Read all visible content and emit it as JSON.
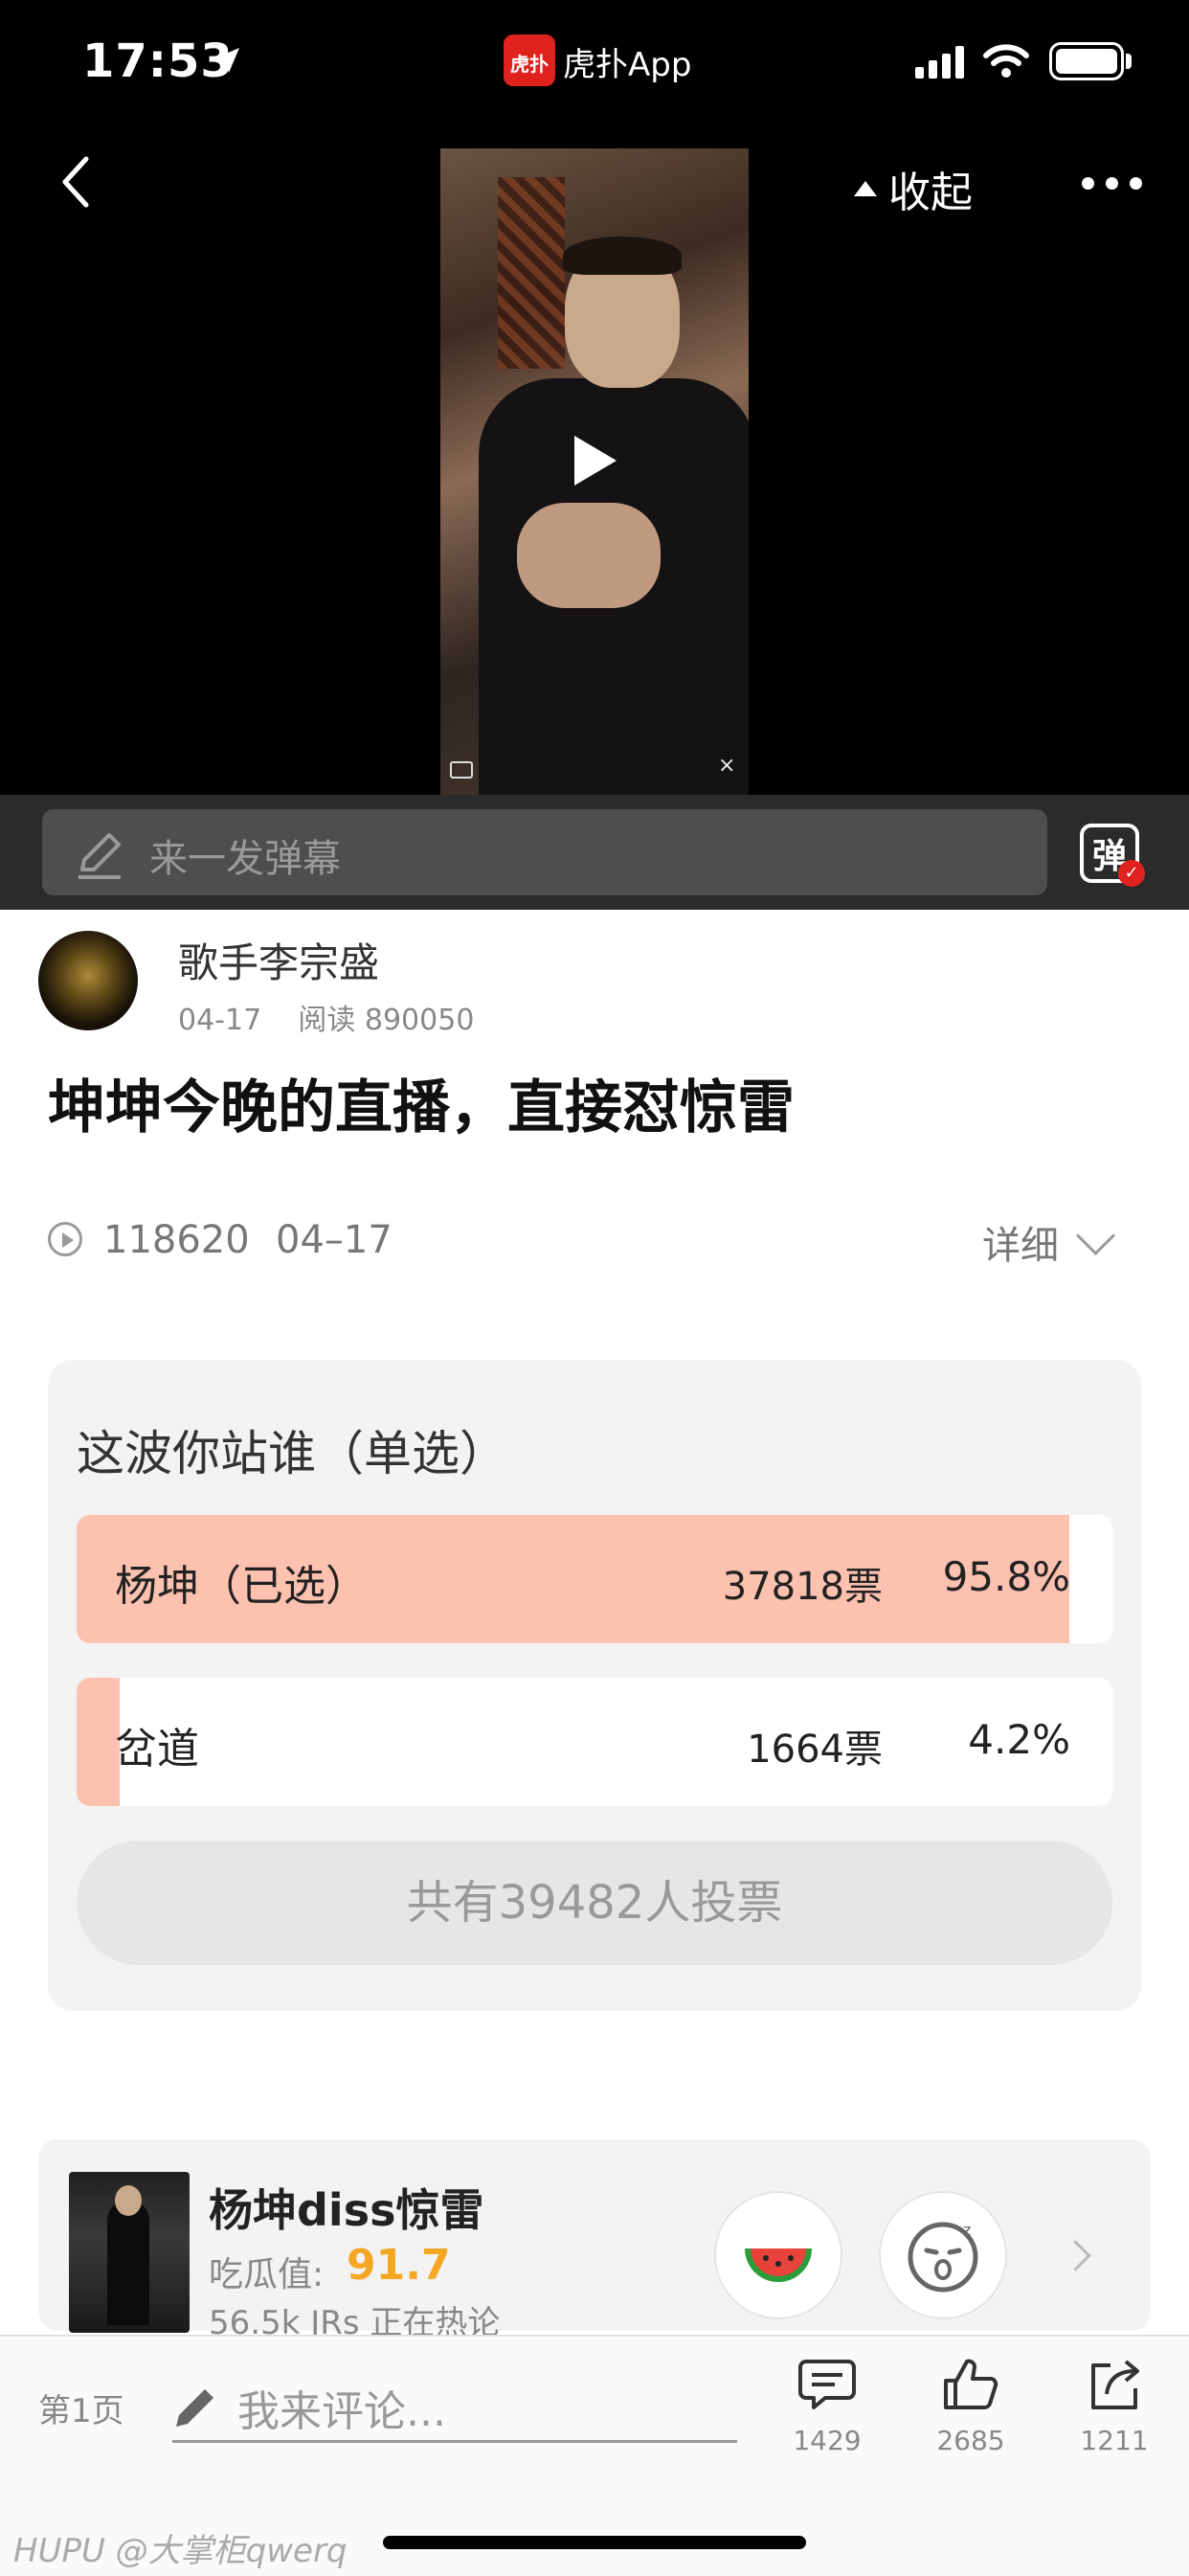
{
  "status_bar": {
    "time": "17:53",
    "app_name": "虎扑App",
    "app_badge": "虎扑"
  },
  "video_header": {
    "collapse_label": "收起"
  },
  "danmaku": {
    "placeholder": "来一发弹幕",
    "toggle_label": "弹",
    "toggle_check": "✓"
  },
  "video": {
    "close_symbol": "×"
  },
  "post": {
    "author": "歌手李宗盛",
    "date": "04-17",
    "reads": "阅读 890050",
    "title": "坤坤今晚的直播，直接怼惊雷",
    "play_count": "118620",
    "play_date": "04–17",
    "detail_label": "详细"
  },
  "poll": {
    "title": "这波你站谁（单选）",
    "options": [
      {
        "label": "杨坤（已选）",
        "votes": "37818票",
        "percent": "95.8%",
        "fraction": 0.958
      },
      {
        "label": "岔道",
        "votes": "1664票",
        "percent": "4.2%",
        "fraction": 0.042
      }
    ],
    "total": "共有39482人投票"
  },
  "topic": {
    "title": "杨坤diss惊雷",
    "melon_label": "吃瓜值:",
    "melon_value": "91.7",
    "hot_text": "56.5k JRs 正在热论"
  },
  "bottom_bar": {
    "page_label": "第1页",
    "comment_placeholder": "我来评论...",
    "comments": "1429",
    "likes": "2685",
    "shares": "1211"
  },
  "watermark": "HUPU @大掌柜qwerq",
  "colors": {
    "poll_fill": "#fdc1b0",
    "melon_value": "#f5a623",
    "brand_red": "#e0221e"
  }
}
